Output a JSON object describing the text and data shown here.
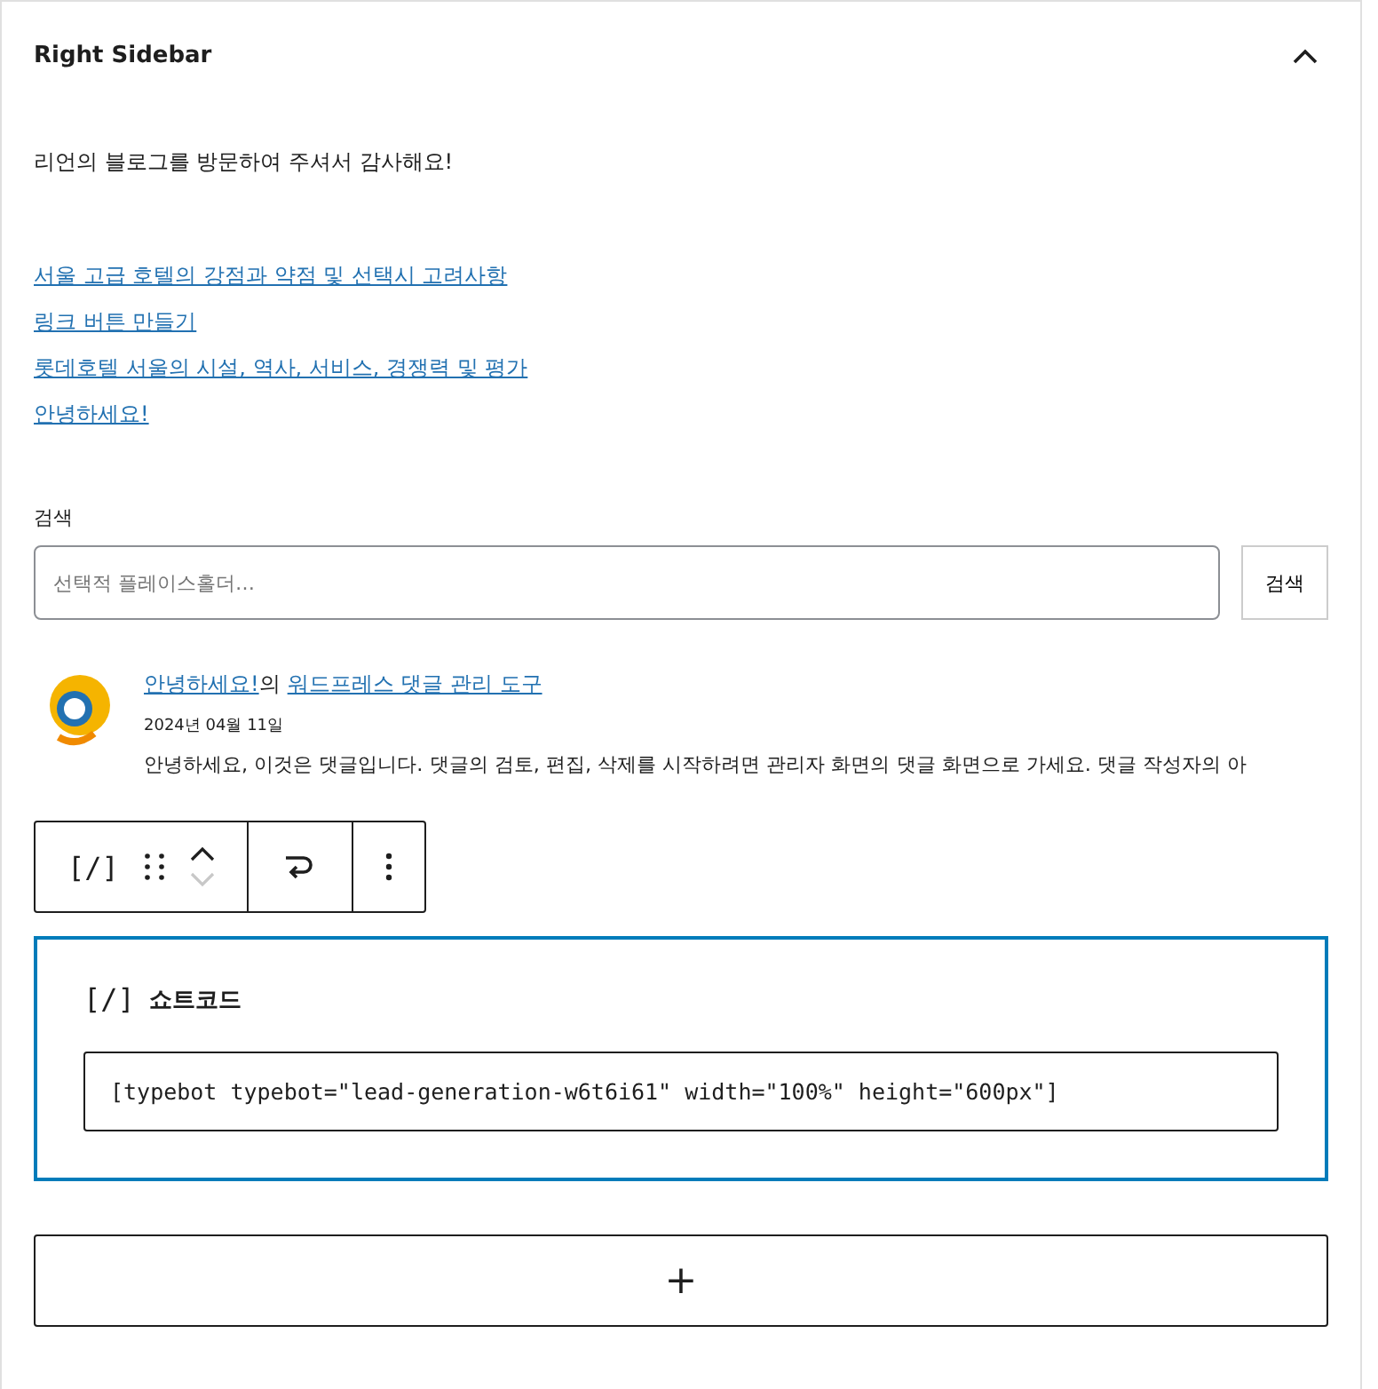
{
  "panel": {
    "title": "Right Sidebar",
    "expanded": true
  },
  "greeting": "리언의 블로그를 방문하여 주셔서 감사해요!",
  "links": [
    "서울 고급 호텔의 강점과 약점 및 선택시 고려사항",
    "링크 버튼 만들기",
    "롯데호텔 서울의 시설, 역사, 서비스, 경쟁력 및 평가",
    "안녕하세요!"
  ],
  "search": {
    "label": "검색",
    "placeholder": "선택적 플레이스홀더…",
    "button": "검색"
  },
  "comment": {
    "author": "안녕하세요!",
    "connector": "의",
    "post": "워드프레스 댓글 관리 도구",
    "date": "2024년 04월 11일",
    "text": "안녕하세요, 이것은 댓글입니다. 댓글의 검토, 편집, 삭제를 시작하려면 관리자 화면의 댓글 화면으로 가세요. 댓글 작성자의 아"
  },
  "toolbar": {
    "block_icon": "[/]",
    "move_up_disabled": false,
    "move_down_disabled": true
  },
  "shortcode": {
    "selected": true,
    "icon": "[/]",
    "title": "쇼트코드",
    "value": "[typebot typebot=\"lead-generation-w6t6i61\" width=\"100%\" height=\"600px\"]"
  },
  "add_button": "+"
}
